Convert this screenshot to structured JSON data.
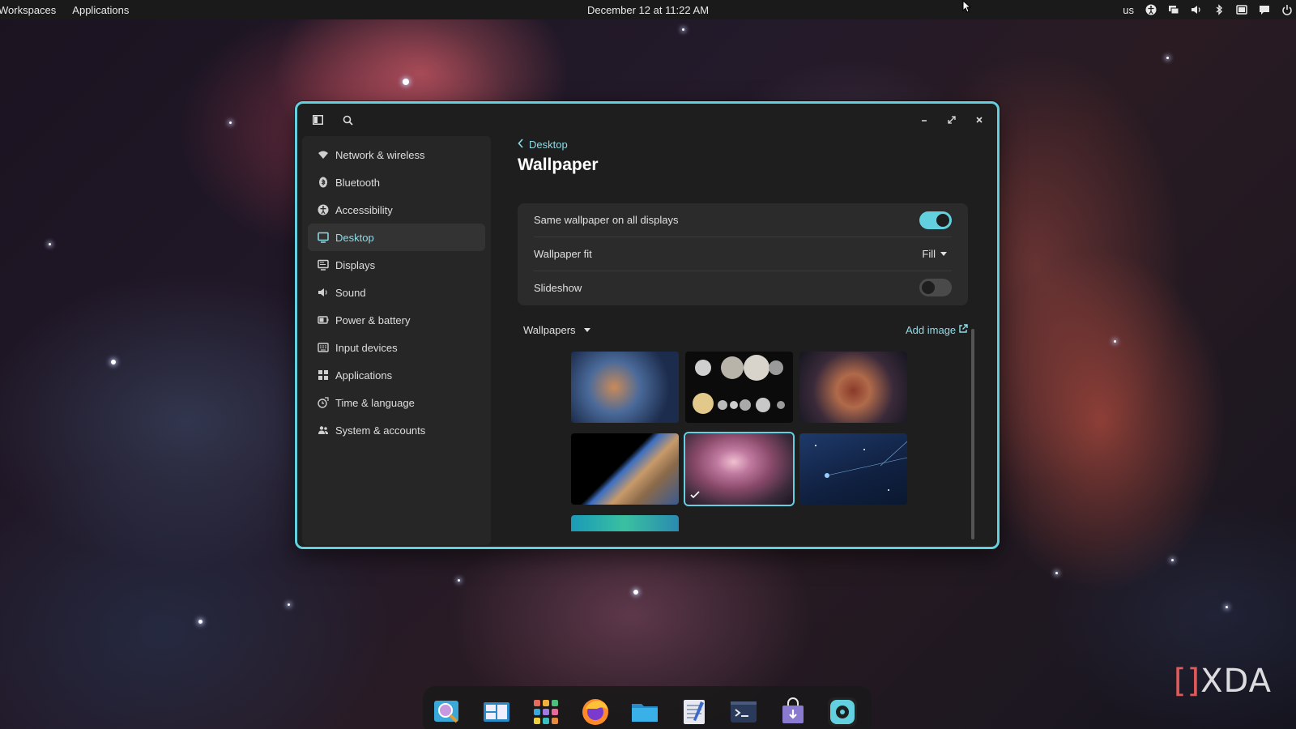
{
  "topbar": {
    "workspaces": "Workspaces",
    "applications": "Applications",
    "clock": "December 12 at 11:22 AM",
    "keyboard_layout": "us",
    "tray_icons": [
      "accessibility-icon",
      "network-icon",
      "volume-icon",
      "bluetooth-icon",
      "battery-icon",
      "notifications-icon",
      "power-icon"
    ]
  },
  "window": {
    "accent": "#62d0df",
    "header": {
      "sidebar_toggle_icon": "sidebar-icon",
      "search_icon": "search-icon"
    },
    "sidebar": {
      "items": [
        {
          "label": "Network & wireless",
          "icon": "wifi-icon"
        },
        {
          "label": "Bluetooth",
          "icon": "bluetooth-icon"
        },
        {
          "label": "Accessibility",
          "icon": "accessibility-icon"
        },
        {
          "label": "Desktop",
          "icon": "monitor-icon",
          "active": true
        },
        {
          "label": "Displays",
          "icon": "display-icon"
        },
        {
          "label": "Sound",
          "icon": "speaker-icon"
        },
        {
          "label": "Power & battery",
          "icon": "battery-icon"
        },
        {
          "label": "Input devices",
          "icon": "keyboard-icon"
        },
        {
          "label": "Applications",
          "icon": "apps-grid-icon"
        },
        {
          "label": "Time & language",
          "icon": "globe-clock-icon"
        },
        {
          "label": "System & accounts",
          "icon": "users-icon"
        }
      ]
    },
    "content": {
      "breadcrumb": "Desktop",
      "title": "Wallpaper",
      "settings": {
        "same_wallpaper_label": "Same wallpaper on all displays",
        "same_wallpaper_on": true,
        "fit_label": "Wallpaper fit",
        "fit_value": "Fill",
        "slideshow_label": "Slideshow",
        "slideshow_on": false
      },
      "source_select": "Wallpapers",
      "add_image": "Add image",
      "wallpapers": [
        {
          "name": "blue-nebula"
        },
        {
          "name": "moons-collection"
        },
        {
          "name": "red-nebula"
        },
        {
          "name": "earth-from-orbit"
        },
        {
          "name": "orion-nebula",
          "selected": true
        },
        {
          "name": "starfield-blue"
        },
        {
          "name": "teal-abstract"
        }
      ]
    }
  },
  "dock": {
    "apps": [
      "search-app-icon",
      "workspaces-app-icon",
      "app-grid-icon",
      "firefox-icon",
      "files-icon",
      "text-editor-icon",
      "terminal-icon",
      "store-icon",
      "settings-app-icon"
    ]
  },
  "watermark": {
    "text": "XDA"
  }
}
